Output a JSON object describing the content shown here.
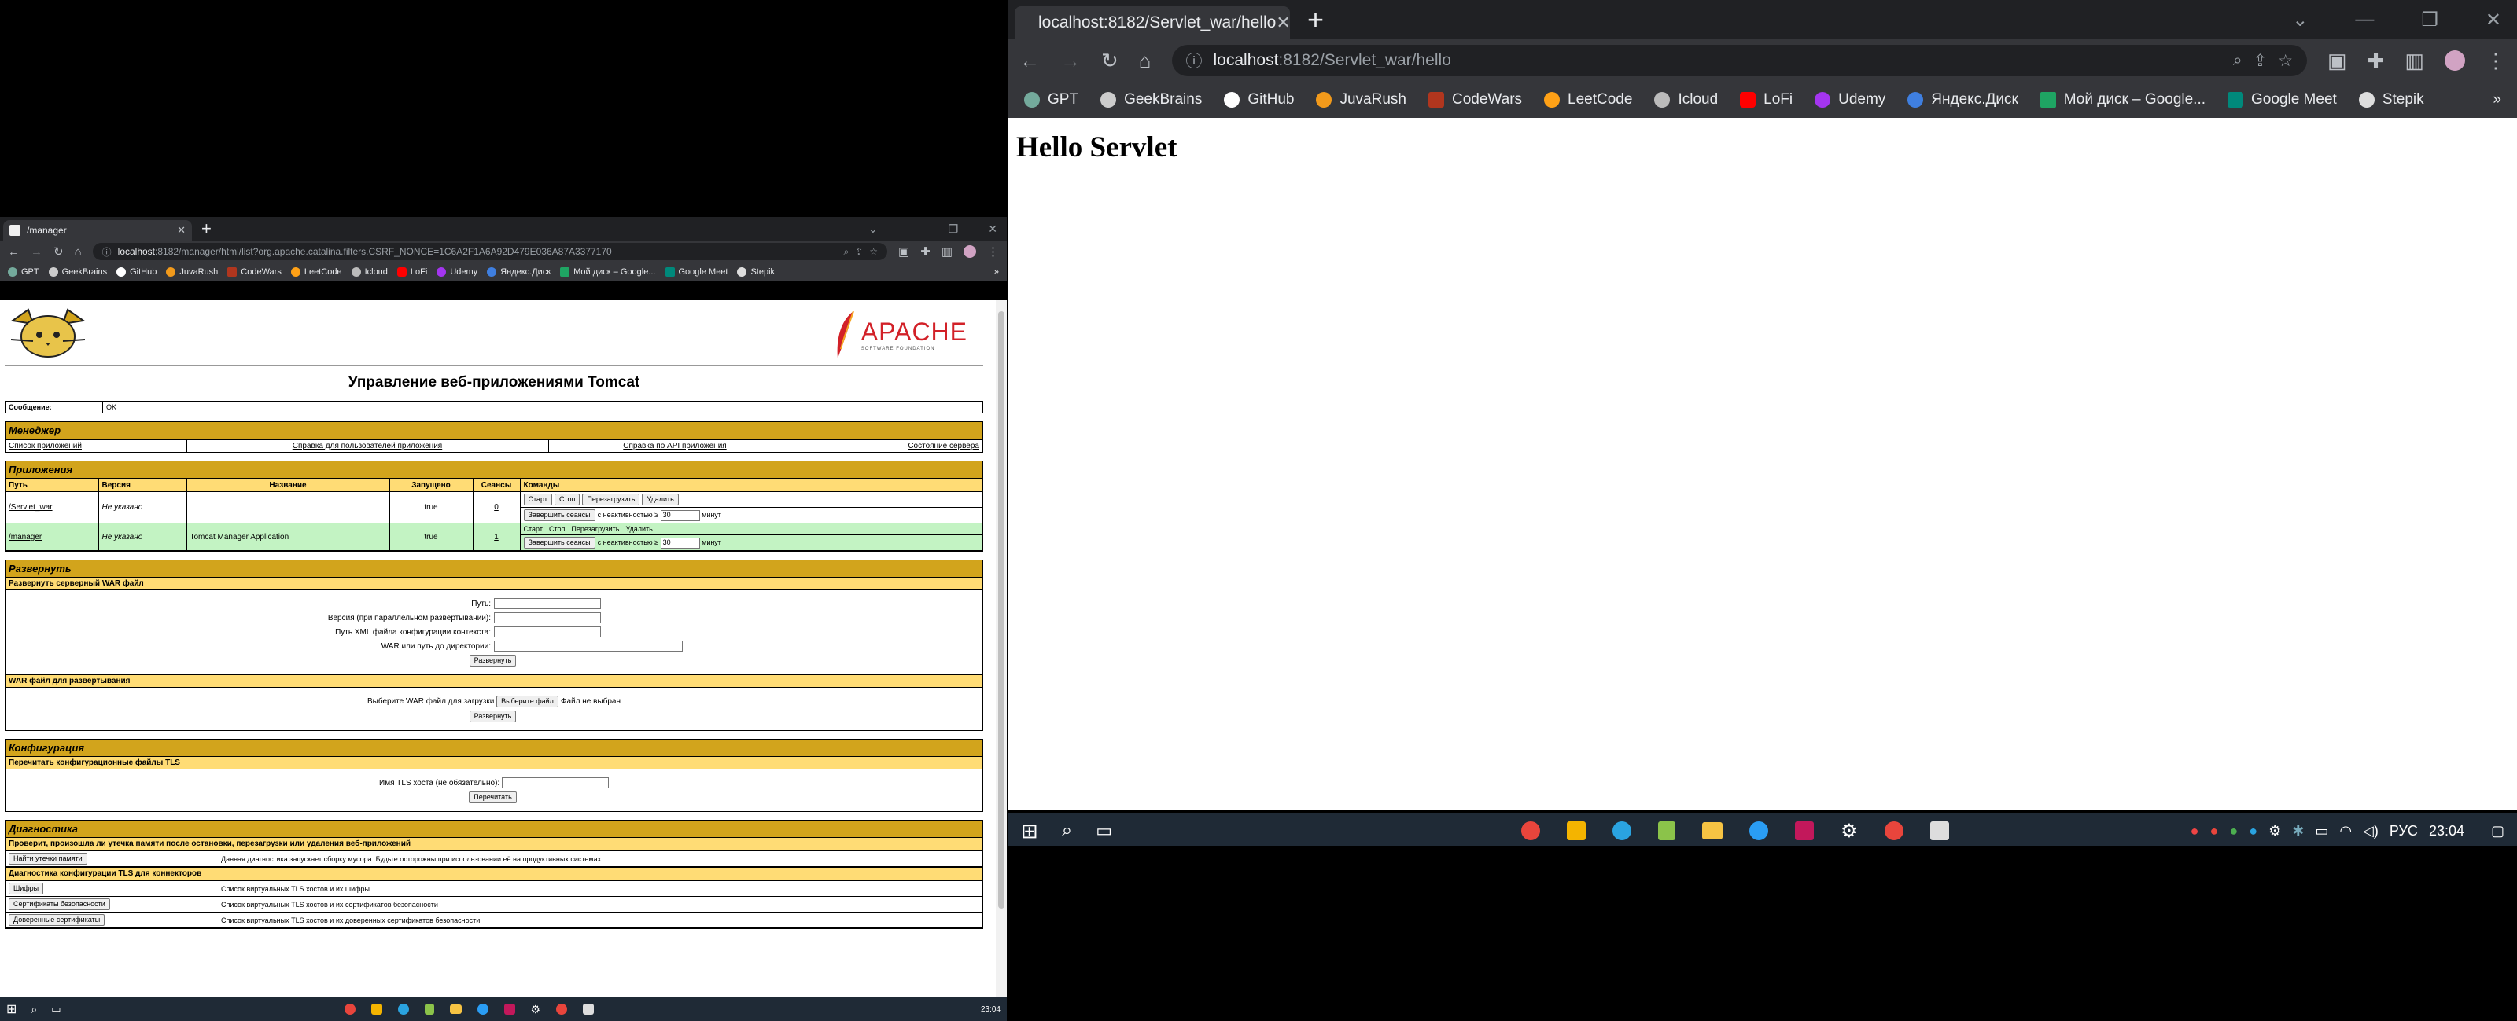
{
  "win2": {
    "tab_title": "localhost:8182/Servlet_war/hello",
    "url_host": "localhost",
    "url_rest": ":8182/Servlet_war/hello",
    "page_heading": "Hello Servlet"
  },
  "win1": {
    "tab_title": "/manager",
    "url_host": "localhost",
    "url_rest": ":8182/manager/html/list?org.apache.catalina.filters.CSRF_NONCE=1C6A2F1A6A92D479E036A87A3377170",
    "page_title": "Управление веб-приложениями Tomcat",
    "message_label": "Сообщение:",
    "message_value": "OK",
    "manager": {
      "title": "Менеджер",
      "links": [
        "Список приложений",
        "Справка для пользователей приложения",
        "Справка по API приложения",
        "Состояние сервера"
      ]
    },
    "apps": {
      "title": "Приложения",
      "headers": [
        "Путь",
        "Версия",
        "Название",
        "Запущено",
        "Сеансы",
        "Команды"
      ],
      "rows": [
        {
          "path": "/Servlet_war",
          "version": "Не указано",
          "name": "",
          "running": "true",
          "sessions": "0"
        },
        {
          "path": "/manager",
          "version": "Не указано",
          "name": "Tomcat Manager Application",
          "running": "true",
          "sessions": "1"
        }
      ],
      "cmd_start": "Старт",
      "cmd_stop": "Стоп",
      "cmd_reload": "Перезагрузить",
      "cmd_undeploy": "Удалить",
      "expire_btn": "Завершить сеансы",
      "idle_label": "с неактивностью ≥",
      "idle_value": "30",
      "minutes": "минут"
    },
    "deploy": {
      "title": "Развернуть",
      "server_war": "Развернуть серверный WAR файл",
      "path_label": "Путь:",
      "version_label": "Версия (при параллельном развёртывании):",
      "xml_label": "Путь XML файла конфигурации контекста:",
      "war_label": "WAR или путь до директории:",
      "deploy_btn": "Развернуть",
      "upload_title": "WAR файл для развёртывания",
      "choose_label": "Выберите WAR файл для загрузки",
      "choose_btn": "Выберите файл",
      "no_file": "Файл не выбран"
    },
    "config": {
      "title": "Конфигурация",
      "tls_reload": "Перечитать конфигурационные файлы TLS",
      "host_label": "Имя TLS хоста (не обязательно):",
      "reload_btn": "Перечитать"
    },
    "diagnostics": {
      "title": "Диагностика",
      "leak_title": "Проверит, произошла ли утечка памяти после остановки, перезагрузки или удаления веб-приложений",
      "leak_btn": "Найти утечки памяти",
      "leak_desc": "Данная диагностика запускает сборку мусора. Будьте осторожны при использовании её на продуктивных системах.",
      "tls_title": "Диагностика конфигурации TLS для коннекторов",
      "ciphers_btn": "Шифры",
      "ciphers_desc": "Список виртуальных TLS хостов и их шифры",
      "certs_btn": "Сертификаты безопасности",
      "certs_desc": "Список виртуальных TLS хостов и их сертификатов безопасности",
      "trusted_btn": "Доверенные сертификаты",
      "trusted_desc": "Список виртуальных TLS хостов и их доверенных сертификатов безопасности"
    }
  },
  "bookmarks": [
    "GPT",
    "GeekBrains",
    "GitHub",
    "JuvaRush",
    "CodeWars",
    "LeetCode",
    "Icloud",
    "LoFi",
    "Udemy",
    "Яндекс.Диск",
    "Мой диск – Google...",
    "Google Meet",
    "Stepik"
  ],
  "taskbar": {
    "lang": "РУС",
    "time": "23:04"
  },
  "colors": {
    "chrome_dark": "#202124",
    "chrome_toolbar": "#35363a",
    "tomcat_section": "#d2a41c",
    "tomcat_sub": "#ffdc75",
    "row_green": "#c3f3c3"
  }
}
